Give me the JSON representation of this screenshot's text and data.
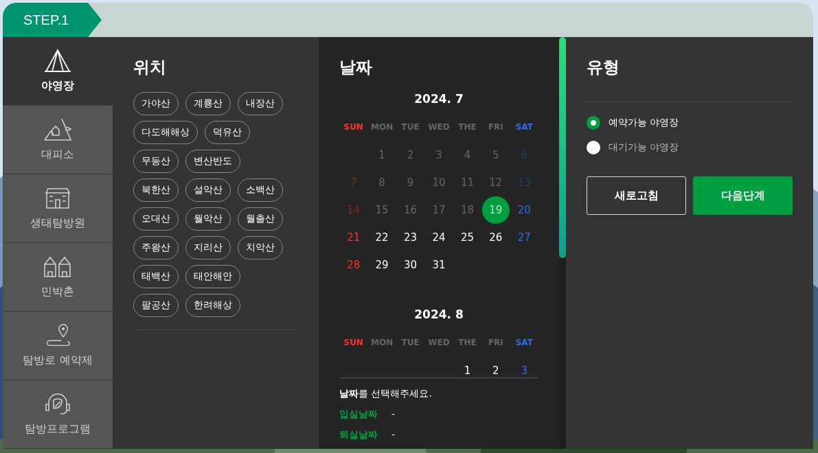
{
  "step": {
    "label": "STEP.1"
  },
  "sidebar": {
    "items": [
      {
        "label": "야영장",
        "selected": true
      },
      {
        "label": "대피소",
        "selected": false
      },
      {
        "label": "생태탐방원",
        "selected": false
      },
      {
        "label": "민박촌",
        "selected": false
      },
      {
        "label": "탐방로 예약제",
        "selected": false
      },
      {
        "label": "탐방프로그램",
        "selected": false
      }
    ]
  },
  "location": {
    "title": "위치",
    "rows": [
      [
        {
          "label": "가야산",
          "selected": false
        },
        {
          "label": "계룡산",
          "selected": false
        },
        {
          "label": "내장산",
          "selected": false
        }
      ],
      [
        {
          "label": "다도해해상",
          "selected": false
        },
        {
          "label": "덕유산",
          "selected": false
        }
      ],
      [
        {
          "label": "무등산",
          "selected": false
        },
        {
          "label": "변산반도",
          "selected": false
        }
      ],
      [
        {
          "label": "북한산",
          "selected": false
        },
        {
          "label": "설악산",
          "selected": false
        },
        {
          "label": "소백산",
          "selected": false
        }
      ],
      [
        {
          "label": "오대산",
          "selected": false
        },
        {
          "label": "월악산",
          "selected": false
        },
        {
          "label": "월출산",
          "selected": false
        }
      ],
      [
        {
          "label": "주왕산",
          "selected": false
        },
        {
          "label": "지리산",
          "selected": false
        },
        {
          "label": "치악산",
          "selected": false
        }
      ],
      [
        {
          "label": "태백산",
          "selected": false
        },
        {
          "label": "태안해안",
          "selected": false
        }
      ],
      [
        {
          "label": "팔공산",
          "selected": false
        },
        {
          "label": "한려해상",
          "selected": false
        }
      ]
    ]
  },
  "date": {
    "title": "날짜",
    "months": [
      {
        "title": "2024. 7",
        "weekdays": [
          "SUN",
          "MON",
          "TUE",
          "WED",
          "THE",
          "FRI",
          "SAT"
        ],
        "weeks": [
          [
            {
              "kind": "blank"
            },
            {
              "kind": "day",
              "d": "1",
              "disabled": true,
              "today": false
            },
            {
              "kind": "day",
              "d": "2",
              "disabled": true,
              "today": false
            },
            {
              "kind": "day",
              "d": "3",
              "disabled": true,
              "today": false
            },
            {
              "kind": "day",
              "d": "4",
              "disabled": true,
              "today": false
            },
            {
              "kind": "day",
              "d": "5",
              "disabled": true,
              "today": false
            },
            {
              "kind": "day",
              "d": "6",
              "disabled": true,
              "today": false
            }
          ],
          [
            {
              "kind": "day",
              "d": "7",
              "disabled": true,
              "today": false
            },
            {
              "kind": "day",
              "d": "8",
              "disabled": true,
              "today": false
            },
            {
              "kind": "day",
              "d": "9",
              "disabled": true,
              "today": false
            },
            {
              "kind": "day",
              "d": "10",
              "disabled": true,
              "today": false
            },
            {
              "kind": "day",
              "d": "11",
              "disabled": true,
              "today": false
            },
            {
              "kind": "day",
              "d": "12",
              "disabled": true,
              "today": false
            },
            {
              "kind": "day",
              "d": "13",
              "disabled": true,
              "today": false
            }
          ],
          [
            {
              "kind": "day",
              "d": "14",
              "disabled": true,
              "today": false
            },
            {
              "kind": "day",
              "d": "15",
              "disabled": true,
              "today": false
            },
            {
              "kind": "day",
              "d": "16",
              "disabled": true,
              "today": false
            },
            {
              "kind": "day",
              "d": "17",
              "disabled": true,
              "today": false
            },
            {
              "kind": "day",
              "d": "18",
              "disabled": true,
              "today": false
            },
            {
              "kind": "day",
              "d": "19",
              "disabled": true,
              "today": true
            },
            {
              "kind": "day",
              "d": "20",
              "disabled": false,
              "today": false
            }
          ],
          [
            {
              "kind": "day",
              "d": "21",
              "disabled": false,
              "today": false
            },
            {
              "kind": "day",
              "d": "22",
              "disabled": false,
              "today": false
            },
            {
              "kind": "day",
              "d": "23",
              "disabled": false,
              "today": false
            },
            {
              "kind": "day",
              "d": "24",
              "disabled": false,
              "today": false
            },
            {
              "kind": "day",
              "d": "25",
              "disabled": false,
              "today": false
            },
            {
              "kind": "day",
              "d": "26",
              "disabled": false,
              "today": false
            },
            {
              "kind": "day",
              "d": "27",
              "disabled": false,
              "today": false
            }
          ],
          [
            {
              "kind": "day",
              "d": "28",
              "disabled": false,
              "today": false
            },
            {
              "kind": "day",
              "d": "29",
              "disabled": false,
              "today": false
            },
            {
              "kind": "day",
              "d": "30",
              "disabled": false,
              "today": false
            },
            {
              "kind": "day",
              "d": "31",
              "disabled": false,
              "today": false
            }
          ]
        ]
      },
      {
        "title": "2024. 8",
        "weekdays": [
          "SUN",
          "MON",
          "TUE",
          "WED",
          "THE",
          "FRI",
          "SAT"
        ],
        "weeks": [
          [
            {
              "kind": "blank"
            },
            {
              "kind": "blank"
            },
            {
              "kind": "blank"
            },
            {
              "kind": "blank"
            },
            {
              "kind": "day",
              "d": "1",
              "disabled": false,
              "today": false
            },
            {
              "kind": "day",
              "d": "2",
              "disabled": false,
              "today": false
            },
            {
              "kind": "day",
              "d": "3",
              "disabled": false,
              "today": false
            }
          ]
        ]
      }
    ],
    "prompt": "**날짜**를 선택해주세요.",
    "fields": [
      {
        "label": "입실날짜",
        "value": "-"
      },
      {
        "label": "퇴실날짜",
        "value": "-"
      }
    ]
  },
  "type": {
    "title": "유형",
    "options": [
      {
        "label": "예약가능 야영장",
        "selected": true
      },
      {
        "label": "대기가능 야영장",
        "selected": false
      }
    ],
    "buttons": [
      {
        "label": "새로고침",
        "kind": "outline"
      },
      {
        "label": "다음단계",
        "kind": "primary"
      }
    ]
  }
}
